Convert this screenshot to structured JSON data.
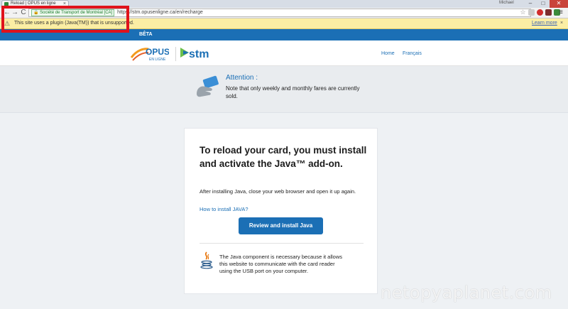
{
  "browser": {
    "tab_title": "Reload | OPUS en ligne",
    "tab_close": "×",
    "user_name": "Michael",
    "win_min": "–",
    "win_max": "□",
    "win_close": "✕",
    "back_glyph": "←",
    "forward_glyph": "→",
    "reload_glyph": "C",
    "ev_label": "Société de Transport de Montréal [CA]",
    "url": "https://stm.opusenligne.ca/en/recharge",
    "menu_glyph": "≡",
    "icons": [
      "back-icon",
      "forward-icon",
      "reload-icon",
      "lock-icon",
      "star-icon",
      "extension-icon",
      "red-circle-icon",
      "shield-icon",
      "green-square-icon",
      "menu-icon"
    ]
  },
  "infobar": {
    "message": "This site uses a plugin (Java(TM)) that is unsupported.",
    "learn_more": "Learn more",
    "close_glyph": "×"
  },
  "site": {
    "beta_label": "BÊTA",
    "nav": {
      "home": "Home",
      "language": "Français"
    },
    "brand_color": "#1b6fb5",
    "logos": {
      "opus": "OPUS",
      "opus_sub": "EN LIGNE",
      "stm": "stm"
    }
  },
  "attention": {
    "title": "Attention :",
    "body": "Note that only weekly and monthly fares are currently sold."
  },
  "card": {
    "title": "To reload your card, you must install and activate the Java™ add-on.",
    "body": "After installing Java, close your web browser and open it up again.",
    "howto_link": "How to install JAVA?",
    "install_button": "Review and install Java",
    "java_note": "The Java component is necessary because it allows this website to communicate with the card reader using the USB port on your computer."
  },
  "watermark": "netopyaplanet.com"
}
